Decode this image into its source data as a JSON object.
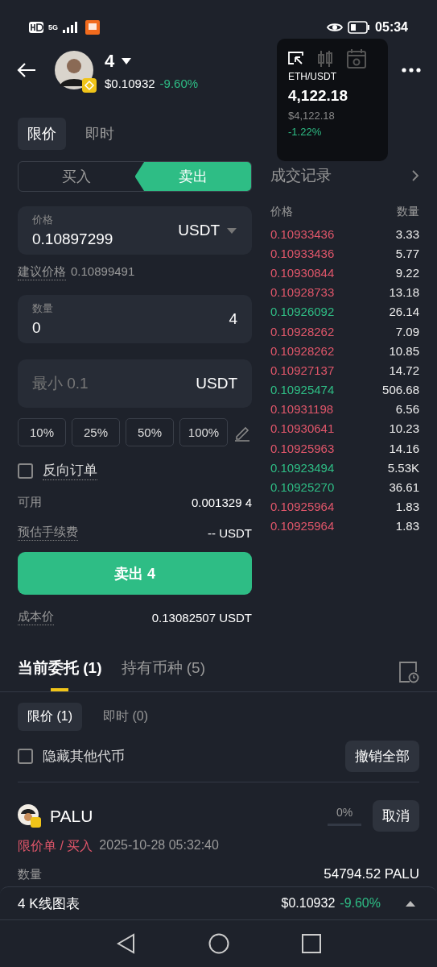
{
  "status_bar": {
    "network": "5G",
    "time": "05:34"
  },
  "header": {
    "symbol": "4",
    "price": "$0.10932",
    "change": "-9.60%"
  },
  "mini_card": {
    "pair": "ETH/USDT",
    "price": "4,122.18",
    "usd_price": "$4,122.18",
    "change": "-1.22%"
  },
  "order_types": [
    {
      "label": "限价",
      "selected": true
    },
    {
      "label": "即时",
      "selected": false
    }
  ],
  "side_toggle": [
    {
      "label": "买入",
      "selected": false
    },
    {
      "label": "卖出",
      "selected": true
    }
  ],
  "price_field": {
    "label": "价格",
    "value": "0.10897299",
    "unit": "USDT"
  },
  "suggested": {
    "label": "建议价格",
    "value": "0.10899491"
  },
  "quantity_field": {
    "label": "数量",
    "value": "0",
    "max": "4"
  },
  "total_field": {
    "placeholder": "最小 0.1",
    "unit": "USDT"
  },
  "percent_buttons": [
    "10%",
    "25%",
    "50%",
    "100%"
  ],
  "reverse_order": {
    "label": "反向订单",
    "checked": false
  },
  "available": {
    "label": "可用",
    "value": "0.001329 4"
  },
  "fee": {
    "label": "预估手续费",
    "value": "-- USDT"
  },
  "sell_button": "卖出 4",
  "cost": {
    "label": "成本价",
    "value": "0.13082507 USDT"
  },
  "trades": {
    "title": "成交记录",
    "columns": [
      "价格",
      "数量"
    ],
    "rows": [
      {
        "price": "0.10933436",
        "qty": "3.33",
        "color": "#e0566a"
      },
      {
        "price": "0.10933436",
        "qty": "5.77",
        "color": "#e0566a"
      },
      {
        "price": "0.10930844",
        "qty": "9.22",
        "color": "#e0566a"
      },
      {
        "price": "0.10928733",
        "qty": "13.18",
        "color": "#e0566a"
      },
      {
        "price": "0.10926092",
        "qty": "26.14",
        "color": "#2ebd85"
      },
      {
        "price": "0.10928262",
        "qty": "7.09",
        "color": "#e0566a"
      },
      {
        "price": "0.10928262",
        "qty": "10.85",
        "color": "#e0566a"
      },
      {
        "price": "0.10927137",
        "qty": "14.72",
        "color": "#e0566a"
      },
      {
        "price": "0.10925474",
        "qty": "506.68",
        "color": "#2ebd85"
      },
      {
        "price": "0.10931198",
        "qty": "6.56",
        "color": "#e0566a"
      },
      {
        "price": "0.10930641",
        "qty": "10.23",
        "color": "#e0566a"
      },
      {
        "price": "0.10925963",
        "qty": "14.16",
        "color": "#e0566a"
      },
      {
        "price": "0.10923494",
        "qty": "5.53K",
        "color": "#2ebd85"
      },
      {
        "price": "0.10925270",
        "qty": "36.61",
        "color": "#2ebd85"
      },
      {
        "price": "0.10925964",
        "qty": "1.83",
        "color": "#e0566a"
      },
      {
        "price": "0.10925964",
        "qty": "1.83",
        "color": "#e0566a"
      }
    ]
  },
  "order_tabs": [
    {
      "label": "当前委托 (1)",
      "selected": true
    },
    {
      "label": "持有币种 (5)",
      "selected": false
    }
  ],
  "sub_tabs": [
    {
      "label": "限价 (1)",
      "selected": true
    },
    {
      "label": "即时 (0)",
      "selected": false
    }
  ],
  "hide_others": {
    "label": "隐藏其他代币",
    "checked": false
  },
  "cancel_all": "撤销全部",
  "order": {
    "coin": "PALU",
    "type": "限价单 / 买入",
    "time": "2025-10-28 05:32:40",
    "progress": "0%",
    "level": 0,
    "cancel": "取消",
    "quantity_label": "数量",
    "quantity_value": "54794.52 PALU"
  },
  "bottom_bar": {
    "title": "4 K线图表",
    "price": "$0.10932",
    "change": "-9.60%"
  }
}
